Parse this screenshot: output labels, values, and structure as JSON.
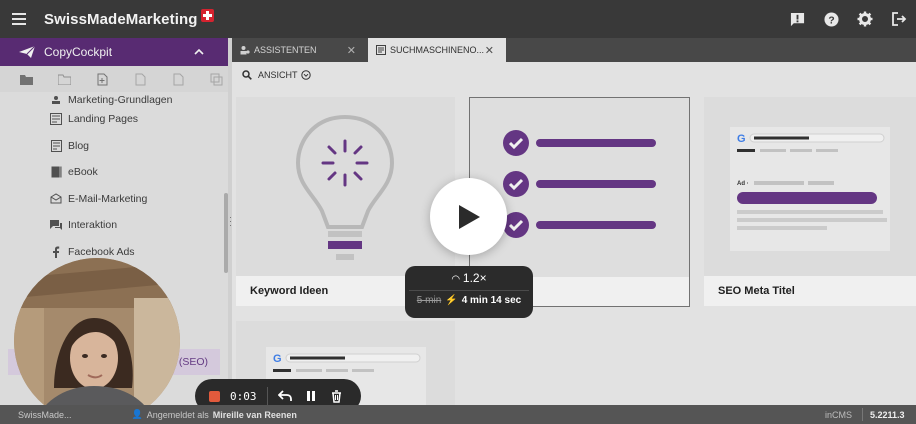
{
  "app": {
    "brand": "SwissMadeMarketing"
  },
  "header": {
    "icons": [
      "chat-alert-icon",
      "help-icon",
      "settings-icon",
      "logout-icon"
    ]
  },
  "sidebar": {
    "section_title": "CopyCockpit",
    "items": [
      {
        "label": "Marketing-Grundlagen",
        "icon": "person-icon"
      },
      {
        "label": "Landing Pages",
        "icon": "page-icon"
      },
      {
        "label": "Blog",
        "icon": "blog-icon"
      },
      {
        "label": "eBook",
        "icon": "book-icon"
      },
      {
        "label": "E-Mail-Marketing",
        "icon": "mail-icon"
      },
      {
        "label": "Interaktion",
        "icon": "chat-icon"
      },
      {
        "label": "Facebook Ads",
        "icon": "facebook-icon"
      }
    ],
    "active_item_visible": "g (SEO)"
  },
  "tabs": [
    {
      "label": "ASSISTENTEN",
      "icon": "assistant-icon"
    },
    {
      "label": "SUCHMASCHINENO...",
      "icon": "document-icon",
      "active": true
    }
  ],
  "toolbar": {
    "view_label": "ANSICHT"
  },
  "cards": [
    {
      "title": "Keyword Ideen"
    },
    {
      "title": ""
    },
    {
      "title": "SEO Meta Titel"
    }
  ],
  "player": {
    "speed": "1.2×",
    "original_time": "5 min",
    "new_time": "4 min 14 sec"
  },
  "recorder": {
    "time": "0:03"
  },
  "statusbar": {
    "brand": "SwissMade...",
    "logged_in_label": "Angemeldet als",
    "user": "Mireille van Reenen",
    "cms": "inCMS",
    "version": "5.2211.3"
  },
  "colors": {
    "accent": "#5e2e7a",
    "purple_bar": "#6b3a8c",
    "topbar": "#393939"
  }
}
